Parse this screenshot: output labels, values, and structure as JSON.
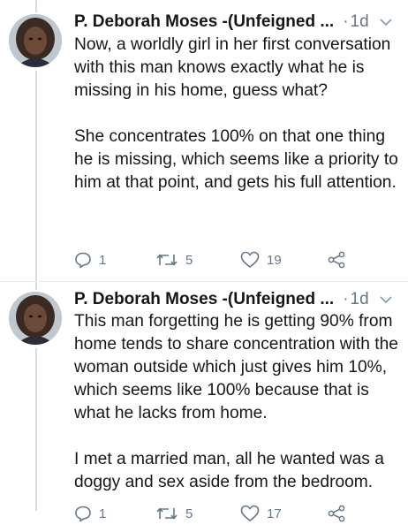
{
  "tweets": [
    {
      "author": "P. Deborah Moses -(Unfeigned ...",
      "separator": "·",
      "time": "1d",
      "paragraphs": [
        "Now, a worldly girl in her first conversation with this man knows exactly what he is missing in his home, guess what?",
        "She concentrates 100% on that one thing he is missing, which seems like a priority to him at that point, and gets his full attention."
      ],
      "replies": "1",
      "retweets": "5",
      "likes": "19"
    },
    {
      "author": "P. Deborah Moses -(Unfeigned ...",
      "separator": "·",
      "time": "1d",
      "paragraphs": [
        "This man forgetting he is getting 90% from home tends to share concentration with the woman outside which just gives him 10%, which seems like 100% because that is what he lacks from home.",
        "I met a married man, all he wanted was a doggy and sex aside from the bedroom."
      ],
      "replies": "1",
      "retweets": "5",
      "likes": "17"
    }
  ],
  "icons": {
    "reply": "reply-icon",
    "retweet": "retweet-icon",
    "like": "heart-icon",
    "share": "share-icon",
    "menu": "chevron-down-icon"
  },
  "colors": {
    "text": "#14171a",
    "muted": "#657786",
    "thread_line": "#d4dbe1"
  }
}
